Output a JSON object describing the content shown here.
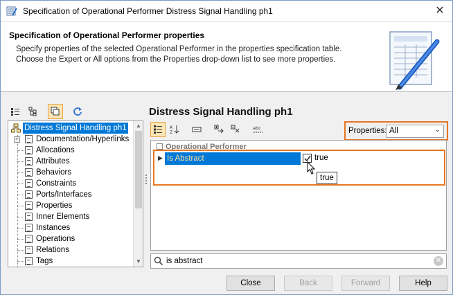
{
  "window": {
    "title": "Specification of Operational Performer Distress Signal Handling ph1"
  },
  "header": {
    "title": "Specification of Operational Performer properties",
    "description": "Specify properties of the selected Operational Performer in the properties specification table. Choose the Expert or All options from the Properties drop-down list to see more properties."
  },
  "element_title": "Distress Signal Handling ph1",
  "tree": {
    "root": "Distress Signal Handling ph1",
    "items": [
      "Documentation/Hyperlinks",
      "Allocations",
      "Attributes",
      "Behaviors",
      "Constraints",
      "Ports/Interfaces",
      "Properties",
      "Inner Elements",
      "Instances",
      "Operations",
      "Relations",
      "Tags"
    ]
  },
  "properties_filter": {
    "label": "Properties:",
    "value": "All"
  },
  "grid": {
    "group": "Operational Performer",
    "rows": [
      {
        "name": "Is Abstract",
        "value": "true",
        "checked": true
      }
    ],
    "tooltip": "true"
  },
  "search": {
    "value": "is abstract"
  },
  "buttons": {
    "close": "Close",
    "back": "Back",
    "forward": "Forward",
    "help": "Help"
  },
  "colors": {
    "selection": "#0078d7",
    "highlight_border": "#e87722"
  }
}
